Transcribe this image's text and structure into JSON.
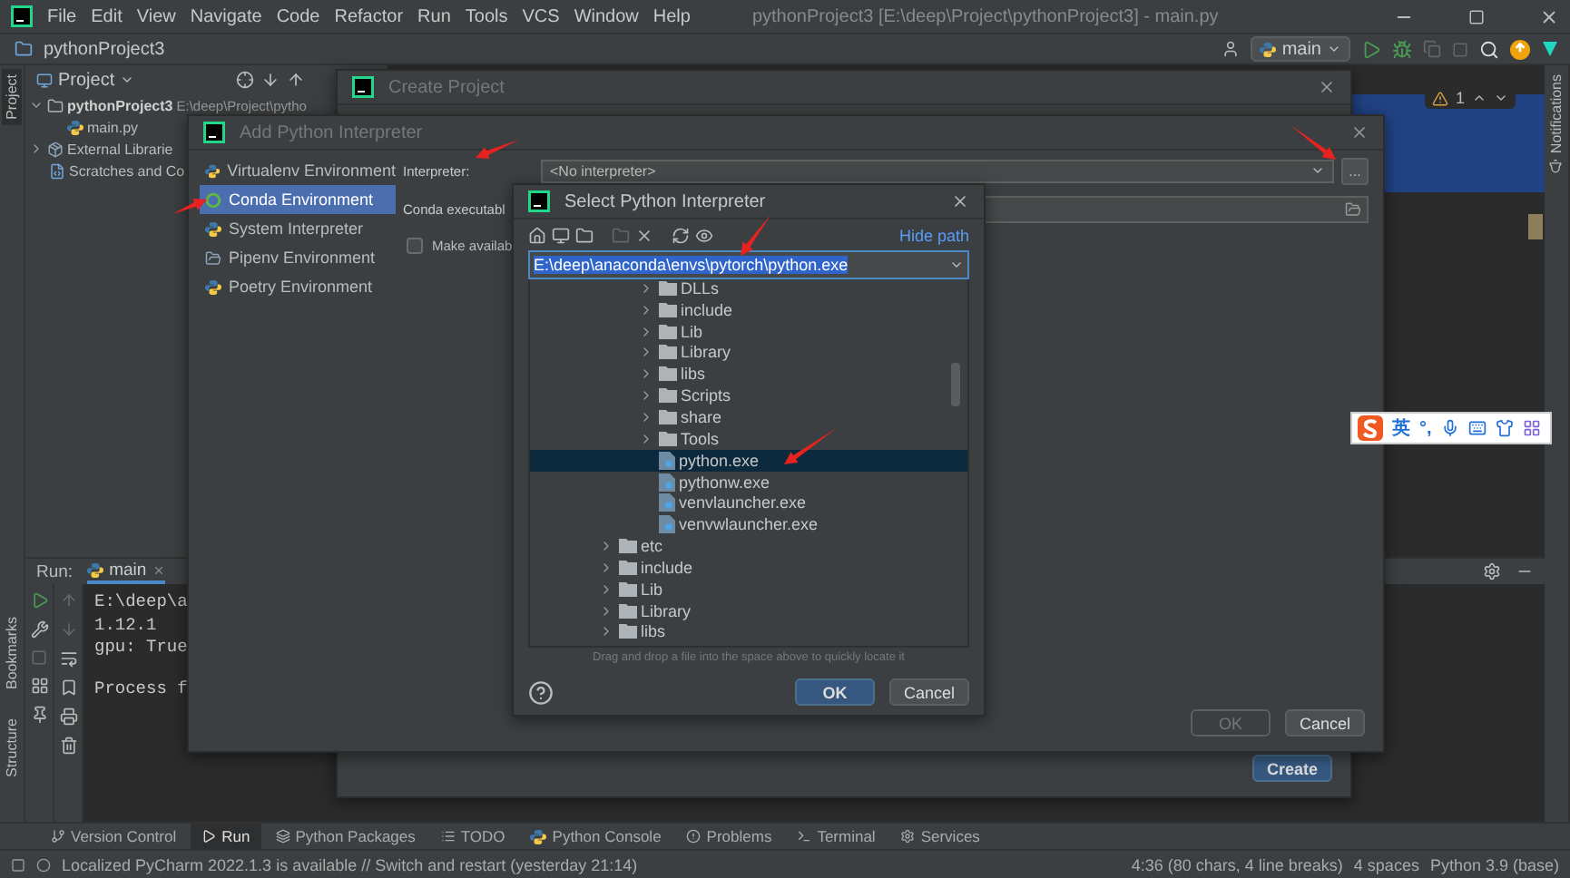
{
  "menu_bar": {
    "items": [
      "File",
      "Edit",
      "View",
      "Navigate",
      "Code",
      "Refactor",
      "Run",
      "Tools",
      "VCS",
      "Window",
      "Help"
    ],
    "title": "pythonProject3 [E:\\deep\\Project\\pythonProject3] - main.py"
  },
  "nav_bar": {
    "breadcrumb": "pythonProject3",
    "branch": "main"
  },
  "tool_strip": [
    {
      "label": "Project",
      "selected": true
    },
    {
      "label": "Bookmarks",
      "selected": false
    },
    {
      "label": "Structure",
      "selected": false
    }
  ],
  "project_panel": {
    "title": "Project",
    "tree": [
      {
        "name": "pythonProject3",
        "path": "E:\\deep\\Project\\pytho",
        "kind": "folder",
        "expanded": true,
        "children": [
          {
            "name": "main.py",
            "kind": "python"
          }
        ]
      },
      {
        "name": "External Librarie",
        "kind": "library",
        "expanded": false
      },
      {
        "name": "Scratches and Co",
        "kind": "scratch"
      }
    ]
  },
  "editor": {
    "warnings": "1"
  },
  "right_strip": {
    "label": "Notifications"
  },
  "run_panel": {
    "label": "Run:",
    "tab": "main",
    "console": [
      [
        "E:\\deep\\a",
        "1.12.1",
        "gpu: True"
      ],
      [
        "Process f"
      ]
    ]
  },
  "tool_windows": [
    {
      "label": "Version Control",
      "kind": "vcs",
      "selected": false
    },
    {
      "label": "Run",
      "kind": "run",
      "selected": true
    },
    {
      "label": "Python Packages",
      "kind": "packages",
      "selected": false
    },
    {
      "label": "TODO",
      "kind": "todo",
      "selected": false
    },
    {
      "label": "Python Console",
      "kind": "console",
      "selected": false
    },
    {
      "label": "Problems",
      "kind": "problems",
      "selected": false
    },
    {
      "label": "Terminal",
      "kind": "terminal",
      "selected": false
    },
    {
      "label": "Services",
      "kind": "services",
      "selected": false
    }
  ],
  "status_bar": {
    "message": "Localized PyCharm 2022.1.3 is available // Switch and restart (yesterday 21:14)",
    "items": [
      "4:36 (80 chars, 4 line breaks)",
      "4 spaces",
      "Python 3.9 (base)"
    ]
  },
  "create_dialog": {
    "title": "Create Project",
    "button": "Create"
  },
  "add_dialog": {
    "title": "Add Python Interpreter",
    "environments": [
      {
        "label": "Virtualenv Environment",
        "kind": "python",
        "selected": false
      },
      {
        "label": "Conda Environment",
        "kind": "conda",
        "selected": true
      },
      {
        "label": "System Interpreter",
        "kind": "python",
        "selected": false
      },
      {
        "label": "Pipenv Environment",
        "kind": "pipenv",
        "selected": false
      },
      {
        "label": "Poetry Environment",
        "kind": "python",
        "selected": false
      }
    ],
    "interpreter_label": "Interpreter:",
    "interpreter_value": "<No interpreter>",
    "browse": "...",
    "conda_label": "Conda executabl",
    "checkbox": {
      "label": "Make availab",
      "checked": false
    },
    "buttons": [
      {
        "label": "OK",
        "disabled": true
      },
      {
        "label": "Cancel",
        "disabled": false
      }
    ]
  },
  "select_dialog": {
    "title": "Select Python Interpreter",
    "hide_path": "Hide path",
    "path": "E:\\deep\\anaconda\\envs\\pytorch\\python.exe",
    "tree": [
      {
        "kind": "hidden",
        "children": [
          {
            "name": "DLLs",
            "kind": "folder",
            "selected": false
          },
          {
            "name": "include",
            "kind": "folder",
            "selected": false
          },
          {
            "name": "Lib",
            "kind": "folder",
            "selected": false
          },
          {
            "name": "Library",
            "kind": "folder",
            "selected": false
          },
          {
            "name": "libs",
            "kind": "folder",
            "selected": false
          },
          {
            "name": "Scripts",
            "kind": "folder",
            "selected": false
          },
          {
            "name": "share",
            "kind": "folder",
            "selected": false
          },
          {
            "name": "Tools",
            "kind": "folder",
            "selected": false
          },
          {
            "name": "python.exe",
            "kind": "file",
            "selected": true
          },
          {
            "name": "pythonw.exe",
            "kind": "file",
            "selected": false
          },
          {
            "name": "venvlauncher.exe",
            "kind": "file",
            "selected": false
          },
          {
            "name": "venvwlauncher.exe",
            "kind": "file",
            "selected": false
          }
        ]
      },
      {
        "name": "etc",
        "kind": "folder",
        "selected": false
      },
      {
        "name": "include",
        "kind": "folder",
        "selected": false
      },
      {
        "name": "Lib",
        "kind": "folder",
        "selected": false
      },
      {
        "name": "Library",
        "kind": "folder",
        "selected": false
      },
      {
        "name": "libs",
        "kind": "folder",
        "selected": false
      }
    ],
    "hint": "Drag and drop a file into the space above to quickly locate it",
    "buttons": [
      {
        "label": "OK",
        "primary": true
      },
      {
        "label": "Cancel",
        "primary": false
      }
    ]
  },
  "ime_bar": {
    "mode": "英",
    "punctuation": "°,"
  }
}
